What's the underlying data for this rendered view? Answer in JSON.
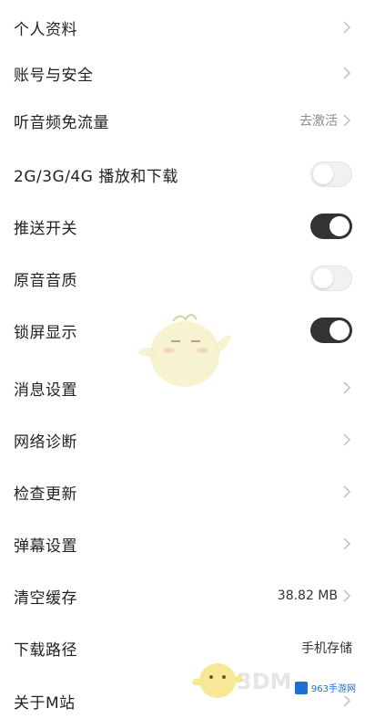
{
  "settings": {
    "personal_info": {
      "label": "个人资料"
    },
    "account_security": {
      "label": "账号与安全"
    },
    "audio_free_data": {
      "label": "听音频免流量",
      "value": "去激活"
    },
    "mobile_network": {
      "label": "2G/3G/4G 播放和下载",
      "enabled": false
    },
    "push_switch": {
      "label": "推送开关",
      "enabled": true
    },
    "original_quality": {
      "label": "原音音质",
      "enabled": false
    },
    "lock_screen": {
      "label": "锁屏显示",
      "enabled": true
    },
    "message_settings": {
      "label": "消息设置"
    },
    "network_diagnosis": {
      "label": "网络诊断"
    },
    "check_update": {
      "label": "检查更新"
    },
    "danmaku_settings": {
      "label": "弹幕设置"
    },
    "clear_cache": {
      "label": "清空缓存",
      "value": "38.82 MB"
    },
    "download_path": {
      "label": "下载路径",
      "value": "手机存储"
    },
    "about": {
      "label": "关于M站"
    }
  },
  "watermark": {
    "brand": "3DM",
    "site": "963手游网"
  },
  "colors": {
    "toggle_on": "#333333",
    "toggle_off": "#f1f1f1",
    "chevron": "#c4c4c4",
    "secondary_text": "#8d8d8d"
  }
}
